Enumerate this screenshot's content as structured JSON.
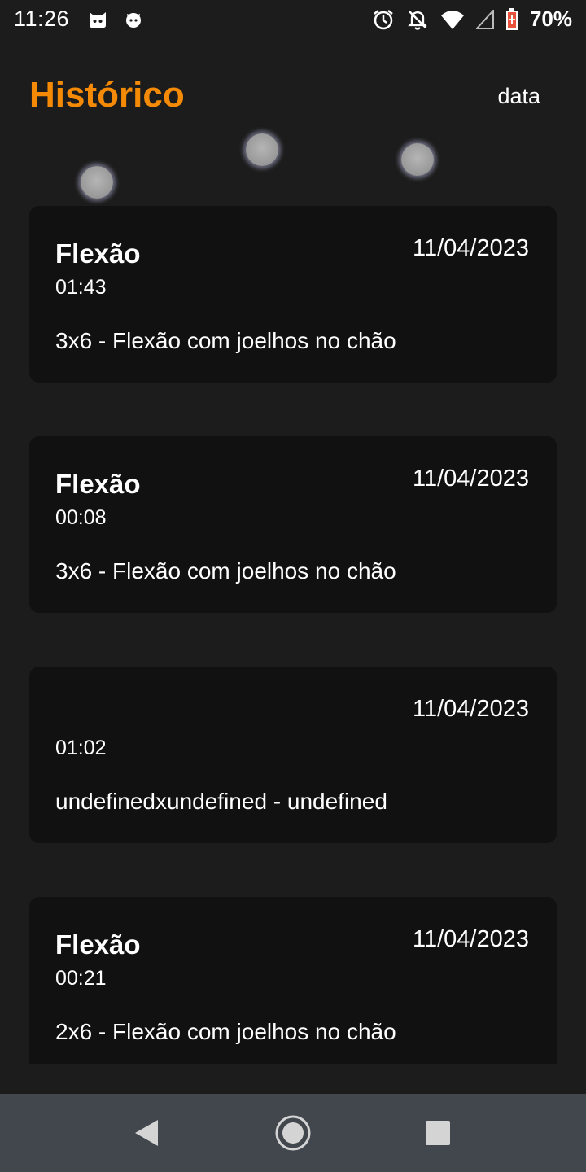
{
  "status_bar": {
    "time": "11:26",
    "left_icons": [
      "cat-notification-icon",
      "cat-notification-icon"
    ],
    "right_icons": [
      "alarm-icon",
      "notifications-off-icon",
      "wifi-icon",
      "signal-icon",
      "battery-charging-icon"
    ],
    "battery_percent": "70%"
  },
  "header": {
    "title": "Histórico",
    "sort_label": "data",
    "accent_color": "#f58a07"
  },
  "history": [
    {
      "name": "Flexão",
      "date": "11/04/2023",
      "duration": "01:43",
      "description": "3x6 - Flexão com joelhos no chão"
    },
    {
      "name": "Flexão",
      "date": "11/04/2023",
      "duration": "00:08",
      "description": "3x6 - Flexão com joelhos no chão"
    },
    {
      "name": "",
      "date": "11/04/2023",
      "duration": "01:02",
      "description": "undefinedxundefined - undefined"
    },
    {
      "name": "Flexão",
      "date": "11/04/2023",
      "duration": "00:21",
      "description": "2x6 - Flexão com joelhos no chão"
    }
  ],
  "nav_bar": {
    "buttons": [
      "back-icon",
      "home-icon",
      "recents-icon"
    ]
  }
}
